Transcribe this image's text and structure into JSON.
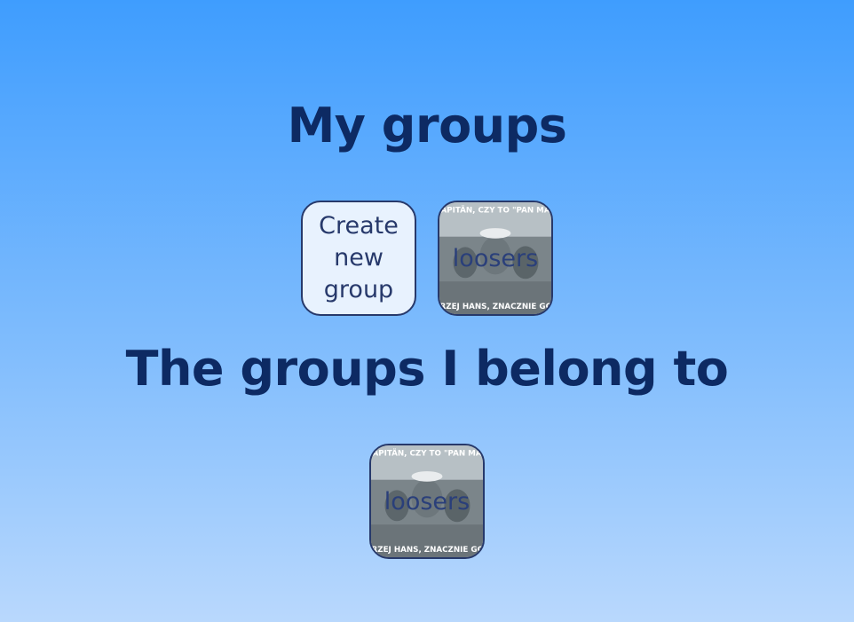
{
  "my_groups": {
    "heading": "My groups",
    "create_label": "Create new group",
    "groups": [
      {
        "name": "loosers",
        "caption_top": "KAPITÄN, CZY TO \"PAN MAR",
        "caption_bottom": "GORZEJ HANS, ZNACZNIE GORZ"
      }
    ]
  },
  "belong": {
    "heading": "The groups I belong to",
    "groups": [
      {
        "name": "loosers",
        "caption_top": "KAPITÄN, CZY TO \"PAN MAR",
        "caption_bottom": "GORZEJ HANS, ZNACZNIE GORZ"
      }
    ]
  }
}
